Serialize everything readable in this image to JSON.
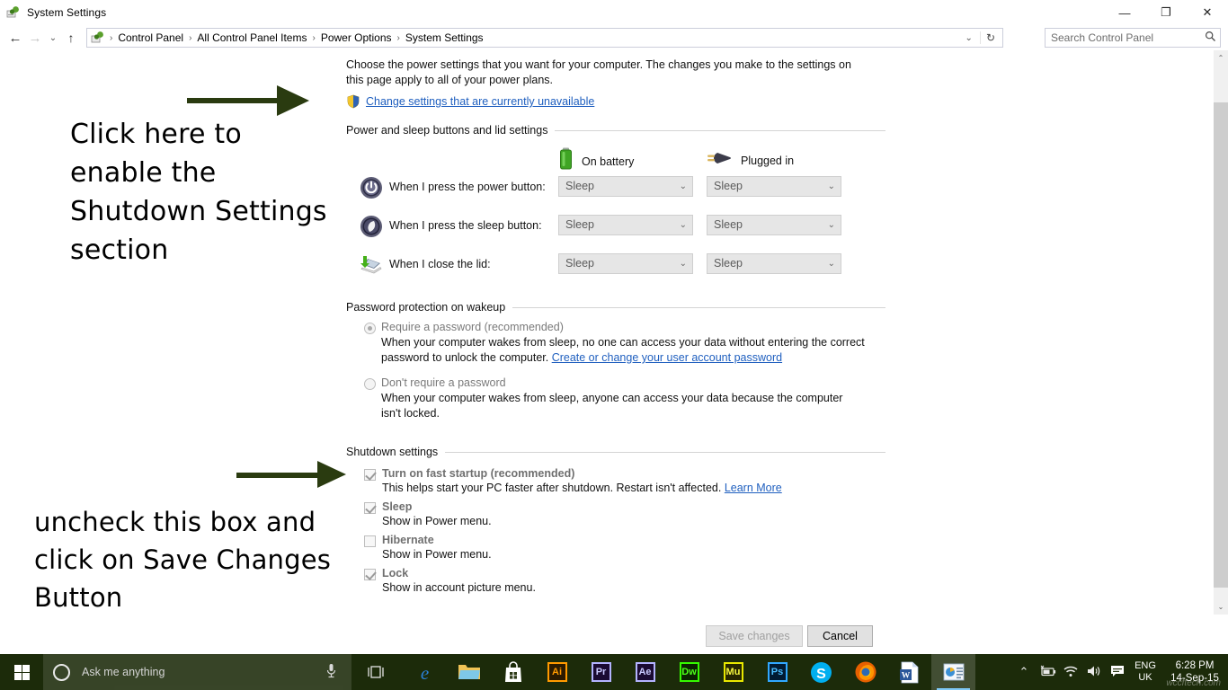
{
  "window": {
    "title": "System Settings",
    "controls": {
      "minimize": "—",
      "maximize": "❐",
      "close": "✕"
    }
  },
  "address_bar": {
    "back_icon": "←",
    "forward_icon": "→",
    "recent_icon": "⌄",
    "up_icon": "↑",
    "breadcrumbs": [
      "Control Panel",
      "All Control Panel Items",
      "Power Options",
      "System Settings"
    ],
    "separator": "›",
    "dropdown_icon": "⌄",
    "refresh_icon": "↻",
    "search_placeholder": "Search Control Panel",
    "search_value": "",
    "search_icon": "⚲"
  },
  "page": {
    "description": "Choose the power settings that you want for your computer. The changes you make to the settings on this page apply to all of your power plans.",
    "admin_link": "Change settings that are currently unavailable"
  },
  "power_buttons_group": {
    "title": "Power and sleep buttons and lid settings",
    "columns": [
      {
        "label": "On battery",
        "icon": "battery-icon"
      },
      {
        "label": "Plugged in",
        "icon": "power-plug-icon"
      }
    ],
    "rows": [
      {
        "icon": "power-button-icon",
        "label": "When I press the power button:",
        "on_battery": "Sleep",
        "plugged_in": "Sleep"
      },
      {
        "icon": "sleep-button-icon",
        "label": "When I press the sleep button:",
        "on_battery": "Sleep",
        "plugged_in": "Sleep"
      },
      {
        "icon": "laptop-lid-icon",
        "label": "When I close the lid:",
        "on_battery": "Sleep",
        "plugged_in": "Sleep"
      }
    ],
    "dropdown_icon": "⌄"
  },
  "password_group": {
    "title": "Password protection on wakeup",
    "options": [
      {
        "label": "Require a password (recommended)",
        "selected": true,
        "description_before": "When your computer wakes from sleep, no one can access your data without entering the correct password to unlock the computer. ",
        "link": "Create or change your user account password"
      },
      {
        "label": "Don't require a password",
        "selected": false,
        "description_before": "When your computer wakes from sleep, anyone can access your data because the computer isn't locked.",
        "link": ""
      }
    ]
  },
  "shutdown_group": {
    "title": "Shutdown settings",
    "items": [
      {
        "label": "Turn on fast startup (recommended)",
        "checked": true,
        "description": "This helps start your PC faster after shutdown. Restart isn't affected. ",
        "link": "Learn More"
      },
      {
        "label": "Sleep",
        "checked": true,
        "description": "Show in Power menu.",
        "link": ""
      },
      {
        "label": "Hibernate",
        "checked": false,
        "description": "Show in Power menu.",
        "link": ""
      },
      {
        "label": "Lock",
        "checked": true,
        "description": "Show in account picture menu.",
        "link": ""
      }
    ]
  },
  "footer": {
    "save_label": "Save changes",
    "save_enabled": false,
    "cancel_label": "Cancel"
  },
  "scrollbar": {
    "up_icon": "⌃",
    "down_icon": "⌄"
  },
  "annotations": [
    {
      "text": "Click here to enable the Shutdown Settings section",
      "arrow_color": "#2a3b10"
    },
    {
      "text": "uncheck this box and click on Save Changes Button",
      "arrow_color": "#2a3b10"
    }
  ],
  "taskbar": {
    "start_icon": "windows-logo-icon",
    "cortana_placeholder": "Ask me anything",
    "cortana_value": "",
    "mic_icon": "⭤",
    "taskview_icon": "❐",
    "apps": [
      {
        "name": "edge-icon",
        "glyph": "e",
        "color": "#2a7fd4",
        "type": "glyph"
      },
      {
        "name": "file-explorer-icon",
        "glyph": "",
        "color": "#f2c14e",
        "type": "folder"
      },
      {
        "name": "microsoft-store-icon",
        "glyph": "",
        "color": "#ffffff",
        "type": "store"
      },
      {
        "name": "adobe-illustrator-icon",
        "glyph": "Ai",
        "color": "#ff9a00",
        "type": "adobe"
      },
      {
        "name": "adobe-premiere-icon",
        "glyph": "Pr",
        "color": "#9999ff",
        "type": "adobe"
      },
      {
        "name": "adobe-after-effects-icon",
        "glyph": "Ae",
        "color": "#9999ff",
        "type": "adobe"
      },
      {
        "name": "adobe-dreamweaver-icon",
        "glyph": "Dw",
        "color": "#35fa00",
        "type": "adobe"
      },
      {
        "name": "adobe-muse-icon",
        "glyph": "Mu",
        "color": "#e8e800",
        "type": "adobe"
      },
      {
        "name": "adobe-photoshop-icon",
        "glyph": "Ps",
        "color": "#31a8ff",
        "type": "adobe"
      },
      {
        "name": "skype-icon",
        "glyph": "S",
        "color": "#00aff0",
        "type": "circle"
      },
      {
        "name": "firefox-icon",
        "glyph": "",
        "color": "#e66000",
        "type": "firefox"
      },
      {
        "name": "microsoft-word-icon",
        "glyph": "W",
        "color": "#2b579a",
        "type": "word"
      },
      {
        "name": "control-panel-icon",
        "glyph": "",
        "color": "#4a90d9",
        "type": "cpanel",
        "active": true
      }
    ],
    "tray": {
      "chevron_icon": "⌃",
      "battery_icon": "🔋",
      "wifi_icon": "◠",
      "volume_icon": "🔊",
      "action_center_icon": "▤",
      "language_line1": "ENG",
      "language_line2": "UK",
      "time": "6:28 PM",
      "date": "14-Sep-15",
      "watermark": "wccftech.com"
    }
  }
}
